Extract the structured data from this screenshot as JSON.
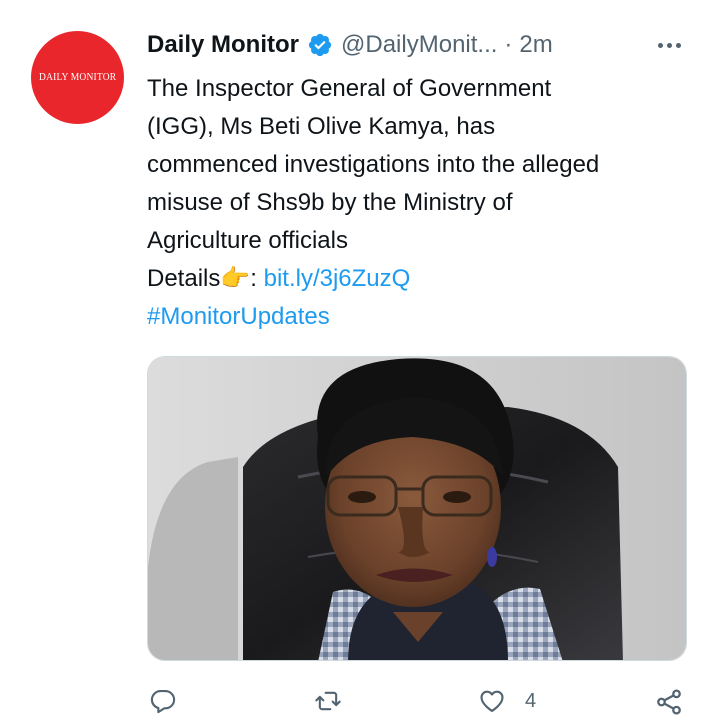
{
  "author": {
    "avatar_text": "DAILY MONITOR",
    "display_name": "Daily Monitor",
    "handle": "@DailyMonit...",
    "separator": "·",
    "time": "2m"
  },
  "tweet": {
    "lines": [
      "The Inspector General of Government",
      "(IGG), Ms Beti Olive Kamya, has",
      "commenced investigations into the alleged",
      "misuse of Shs9b by the Ministry of",
      "Agriculture officials"
    ],
    "details_label": "Details",
    "details_emoji": "👉",
    "details_colon": ": ",
    "link": "bit.ly/3j6ZuzQ",
    "hashtag": "#MonitorUpdates"
  },
  "actions": {
    "like_count": "4"
  },
  "colors": {
    "link": "#1d9bf0",
    "verified": "#1d9bf0",
    "avatar": "#e8262c",
    "muted": "#536471"
  },
  "icons": [
    "verified-badge-icon",
    "more-icon",
    "reply-icon",
    "retweet-icon",
    "like-icon",
    "share-icon"
  ]
}
